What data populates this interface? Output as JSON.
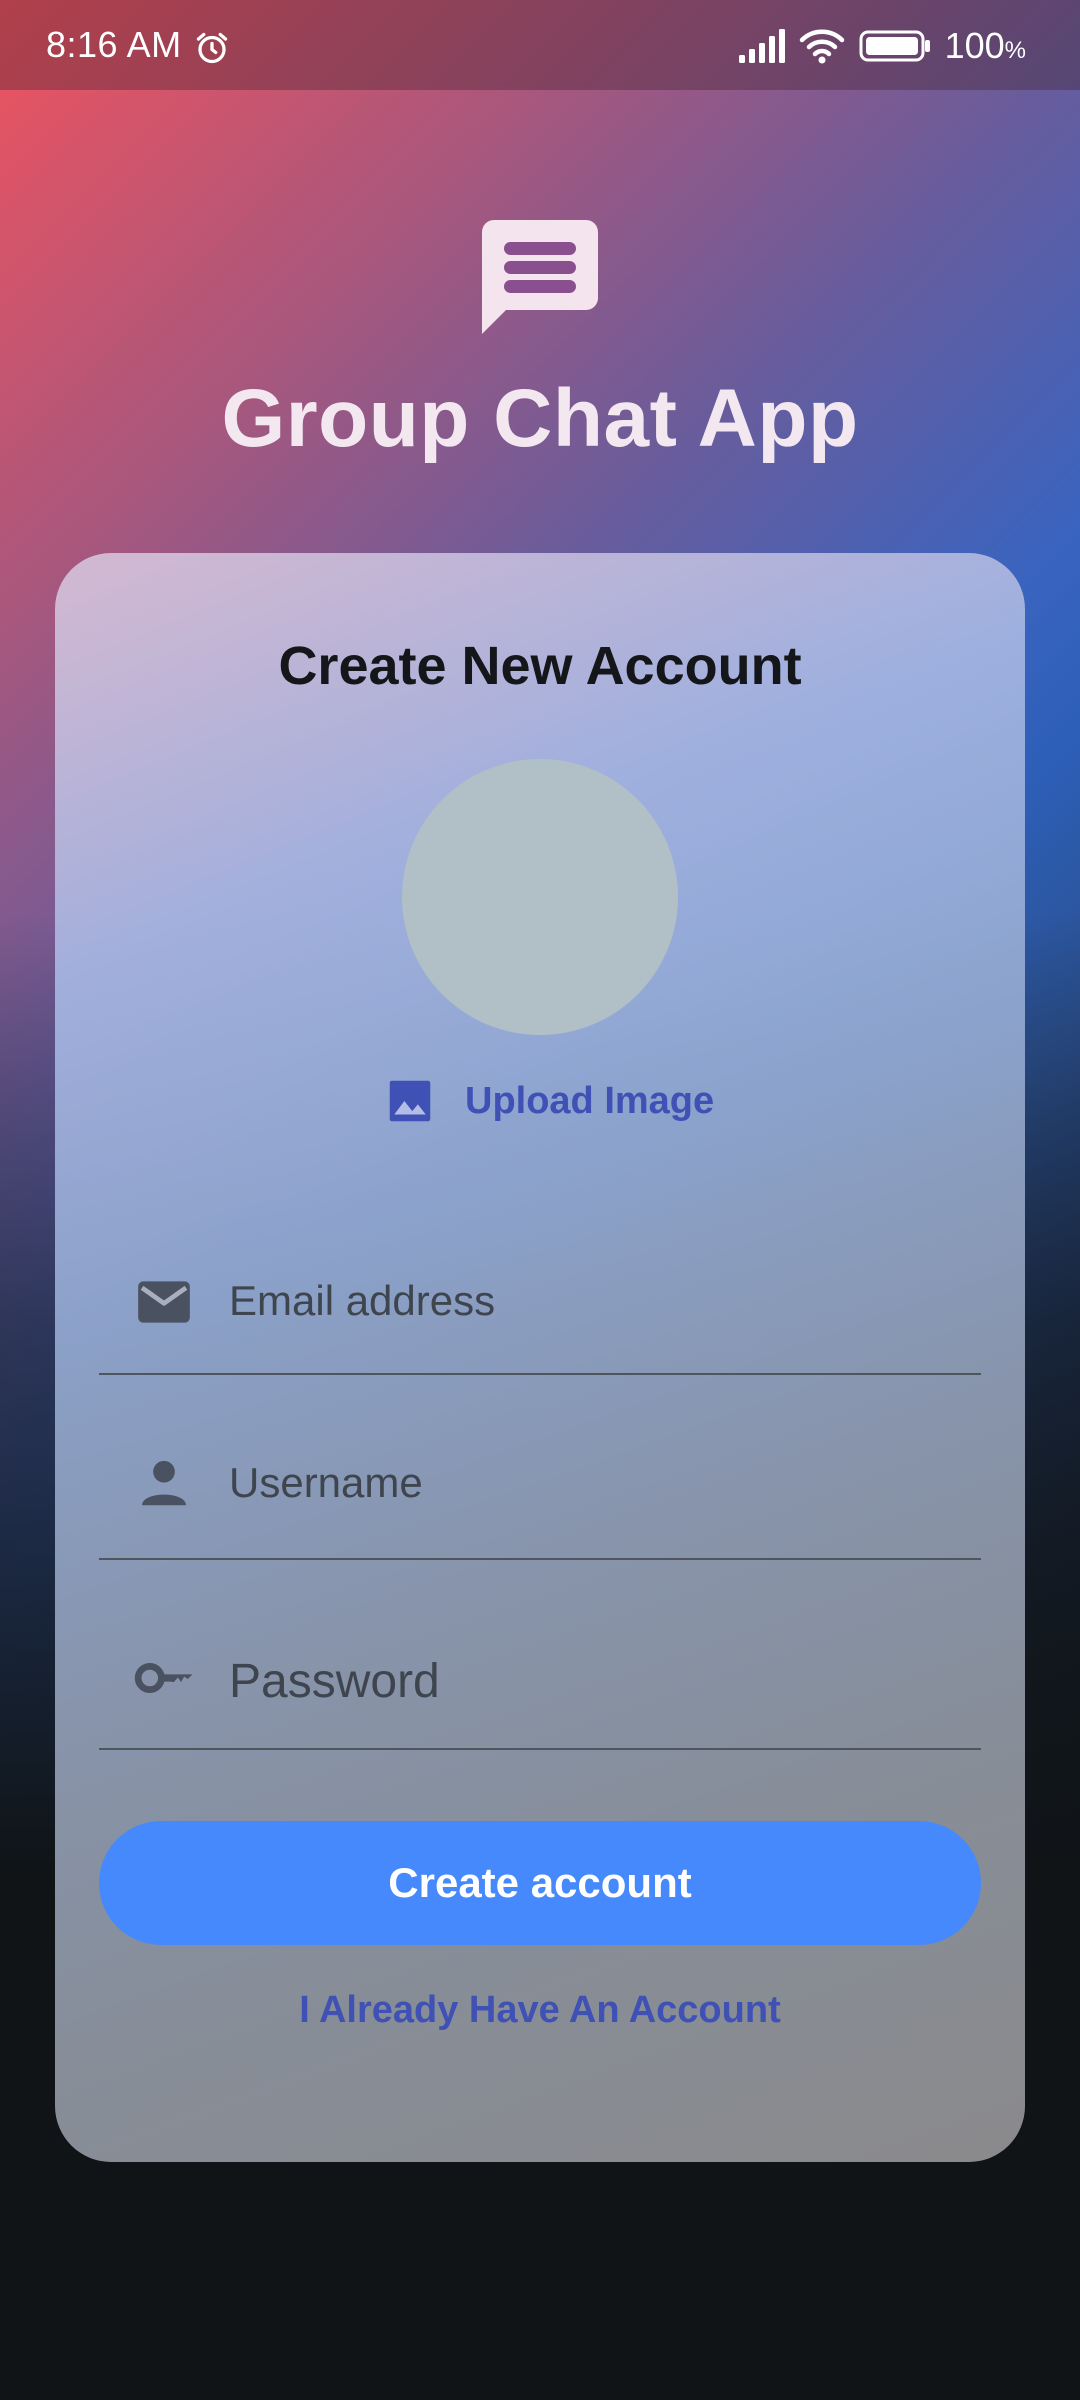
{
  "status_bar": {
    "time": "8:16 AM",
    "battery_value": "100",
    "battery_unit": "%",
    "icons": [
      "alarm-icon",
      "signal-icon",
      "wifi-icon",
      "battery-icon"
    ]
  },
  "header": {
    "logo_icon": "chat-bubble-icon",
    "title": "Group Chat App"
  },
  "card": {
    "title": "Create New Account",
    "upload_icon": "image-icon",
    "upload_label": "Upload Image",
    "fields": {
      "email": {
        "icon": "email-icon",
        "placeholder": "Email address",
        "value": ""
      },
      "username": {
        "icon": "person-icon",
        "placeholder": "Username",
        "value": ""
      },
      "password": {
        "icon": "key-icon",
        "placeholder": "Password",
        "value": ""
      }
    },
    "create_button_label": "Create account",
    "login_link_label": "I Already Have An Account"
  },
  "colors": {
    "primary_button": "#4589fd",
    "link": "#3f51b5",
    "title": "#f4e8f0",
    "avatar_placeholder": "#b1bfc6"
  }
}
